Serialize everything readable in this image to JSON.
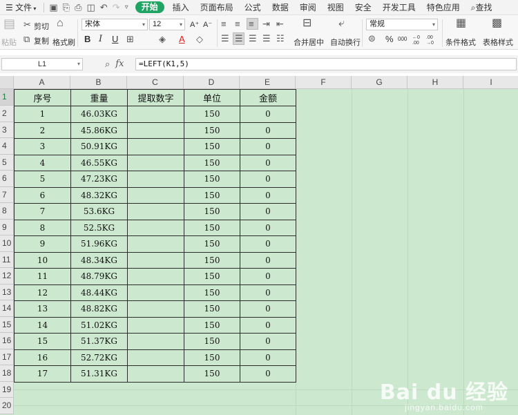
{
  "menu": {
    "file": "文件",
    "tabs": [
      "开始",
      "插入",
      "页面布局",
      "公式",
      "数据",
      "审阅",
      "视图",
      "安全",
      "开发工具",
      "特色应用"
    ],
    "active_tab": "开始",
    "search": "查找"
  },
  "ribbon": {
    "paste": "粘贴",
    "cut": "剪切",
    "copy": "复制",
    "format_painter": "格式刷",
    "font_name": "宋体",
    "font_size": "12",
    "bold": "B",
    "italic": "I",
    "underline": "U",
    "grow_font": "A⁺",
    "shrink_font": "A⁻",
    "font_color_glyph": "A",
    "merge_center": "合并居中",
    "wrap_text": "自动换行",
    "number_format": "常规",
    "percent": "%",
    "comma": "000",
    "inc_decimal": "←0 .00",
    "dec_decimal": ".00 →0",
    "conditional_format": "条件格式",
    "table_style": "表格样式"
  },
  "formula_bar": {
    "name_box": "L1",
    "formula": "=LEFT(K1,5)"
  },
  "columns": [
    "A",
    "B",
    "C",
    "D",
    "E",
    "F",
    "G",
    "H",
    "I"
  ],
  "rows": [
    "1",
    "2",
    "3",
    "4",
    "5",
    "6",
    "7",
    "8",
    "9",
    "10",
    "11",
    "12",
    "13",
    "14",
    "15",
    "16",
    "17",
    "18",
    "19",
    "20"
  ],
  "table": {
    "headers": [
      "序号",
      "重量",
      "提取数字",
      "单位",
      "金额"
    ],
    "rows": [
      [
        "1",
        "46.03KG",
        "",
        "150",
        "0"
      ],
      [
        "2",
        "45.86KG",
        "",
        "150",
        "0"
      ],
      [
        "3",
        "50.91KG",
        "",
        "150",
        "0"
      ],
      [
        "4",
        "46.55KG",
        "",
        "150",
        "0"
      ],
      [
        "5",
        "47.23KG",
        "",
        "150",
        "0"
      ],
      [
        "6",
        "48.32KG",
        "",
        "150",
        "0"
      ],
      [
        "7",
        "53.6KG",
        "",
        "150",
        "0"
      ],
      [
        "8",
        "52.5KG",
        "",
        "150",
        "0"
      ],
      [
        "9",
        "51.96KG",
        "",
        "150",
        "0"
      ],
      [
        "10",
        "48.34KG",
        "",
        "150",
        "0"
      ],
      [
        "11",
        "48.79KG",
        "",
        "150",
        "0"
      ],
      [
        "12",
        "48.44KG",
        "",
        "150",
        "0"
      ],
      [
        "13",
        "48.82KG",
        "",
        "150",
        "0"
      ],
      [
        "14",
        "51.02KG",
        "",
        "150",
        "0"
      ],
      [
        "15",
        "51.37KG",
        "",
        "150",
        "0"
      ],
      [
        "16",
        "52.72KG",
        "",
        "150",
        "0"
      ],
      [
        "17",
        "51.31KG",
        "",
        "150",
        "0"
      ]
    ]
  },
  "watermark": {
    "brand": "Bai du 经验",
    "url": "jingyan.baidu.com"
  },
  "colors": {
    "accent": "#1fa463",
    "grid_bg": "#cce8cf",
    "selected_header_text": "#1e7b46"
  }
}
